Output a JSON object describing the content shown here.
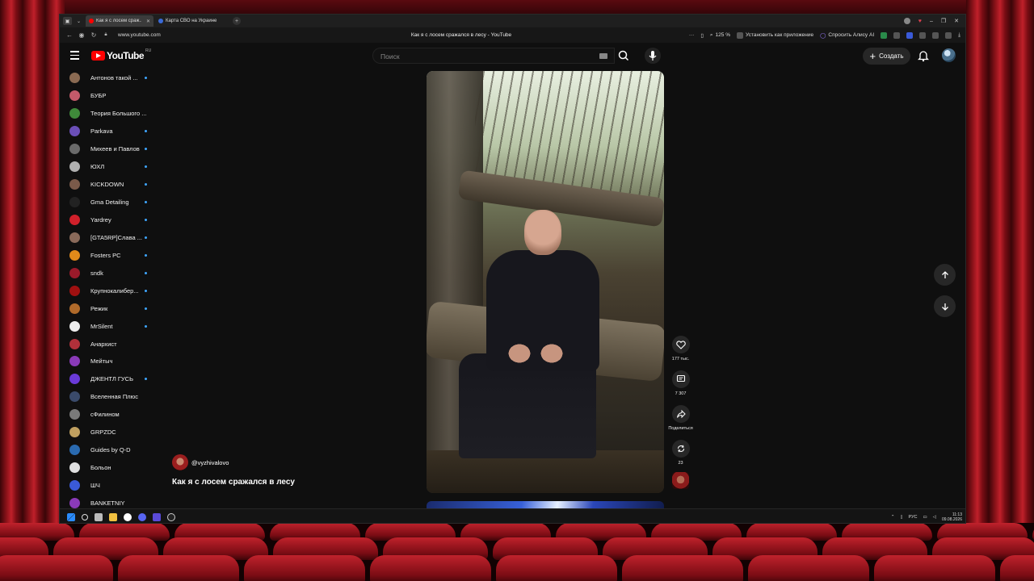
{
  "browser": {
    "tabs": [
      {
        "label": "Как я с лосем сраж...",
        "active": true
      },
      {
        "label": "Карта СВО на Украине",
        "active": false
      }
    ],
    "url": "www.youtube.com",
    "page_title": "Как я с лосем сражался в лесу - YouTube",
    "zoom": "125 %",
    "install_app": "Установить как приложение",
    "ask_alice": "Спросить Алису AI"
  },
  "header": {
    "logo_text": "YouTube",
    "logo_region": "RU",
    "search_placeholder": "Поиск",
    "create_label": "Создать"
  },
  "sidebar": {
    "items": [
      {
        "label": "Антонов такой ...",
        "color": "#8a6a52",
        "dot": true
      },
      {
        "label": "БУБР",
        "color": "#c45a6a",
        "dot": false
      },
      {
        "label": "Теория Большого ...",
        "color": "#3f8a3a",
        "dot": false
      },
      {
        "label": "Parkava",
        "color": "#6b4fb8",
        "dot": true
      },
      {
        "label": "Михеев и Павлов",
        "color": "#6a6a6a",
        "dot": true
      },
      {
        "label": "ЮХЛ",
        "color": "#b0b0b0",
        "dot": true
      },
      {
        "label": "KICKDOWN",
        "color": "#7a5a4a",
        "dot": true
      },
      {
        "label": "Gma Detailing",
        "color": "#222222",
        "dot": true
      },
      {
        "label": "Yardrey",
        "color": "#d0202a",
        "dot": true
      },
      {
        "label": "[GTA5RP]Слава ...",
        "color": "#8a6a5a",
        "dot": true
      },
      {
        "label": "Fosters PC",
        "color": "#e08a1a",
        "dot": true
      },
      {
        "label": "sndk",
        "color": "#9a1a2a",
        "dot": true
      },
      {
        "label": "Крупнокалибер...",
        "color": "#a01010",
        "dot": true
      },
      {
        "label": "Режик",
        "color": "#b06a2a",
        "dot": true
      },
      {
        "label": "MrSilent",
        "color": "#eeeeee",
        "dot": true
      },
      {
        "label": "Анархист",
        "color": "#b0303a",
        "dot": false
      },
      {
        "label": "Мейтыч",
        "color": "#8a3ab8",
        "dot": false
      },
      {
        "label": "ДЖЕНТЛ ГУСЬ",
        "color": "#6a3ad8",
        "dot": true
      },
      {
        "label": "Вселенная Плюс",
        "color": "#3a4a6a",
        "dot": false
      },
      {
        "label": "сФилином",
        "color": "#7a7a7a",
        "dot": false
      },
      {
        "label": "GRPZDC",
        "color": "#c0a060",
        "dot": false
      },
      {
        "label": "Guides by Q-D",
        "color": "#2a6ab0",
        "dot": false
      },
      {
        "label": "Больон",
        "color": "#e0e0e0",
        "dot": false
      },
      {
        "label": "ШЧ",
        "color": "#3a5ad8",
        "dot": false
      },
      {
        "label": "BANKETNIY",
        "color": "#8a3ab8",
        "dot": false
      }
    ]
  },
  "video": {
    "channel_handle": "@vyzhivalovo",
    "title": "Как я с лосем сражался в лесу",
    "likes": "177 тыс.",
    "comments": "7 307",
    "share_label": "Поделиться",
    "remix_count": "23"
  },
  "taskbar": {
    "lang": "РУС",
    "time": "11:13",
    "date": "09.08.2026"
  }
}
